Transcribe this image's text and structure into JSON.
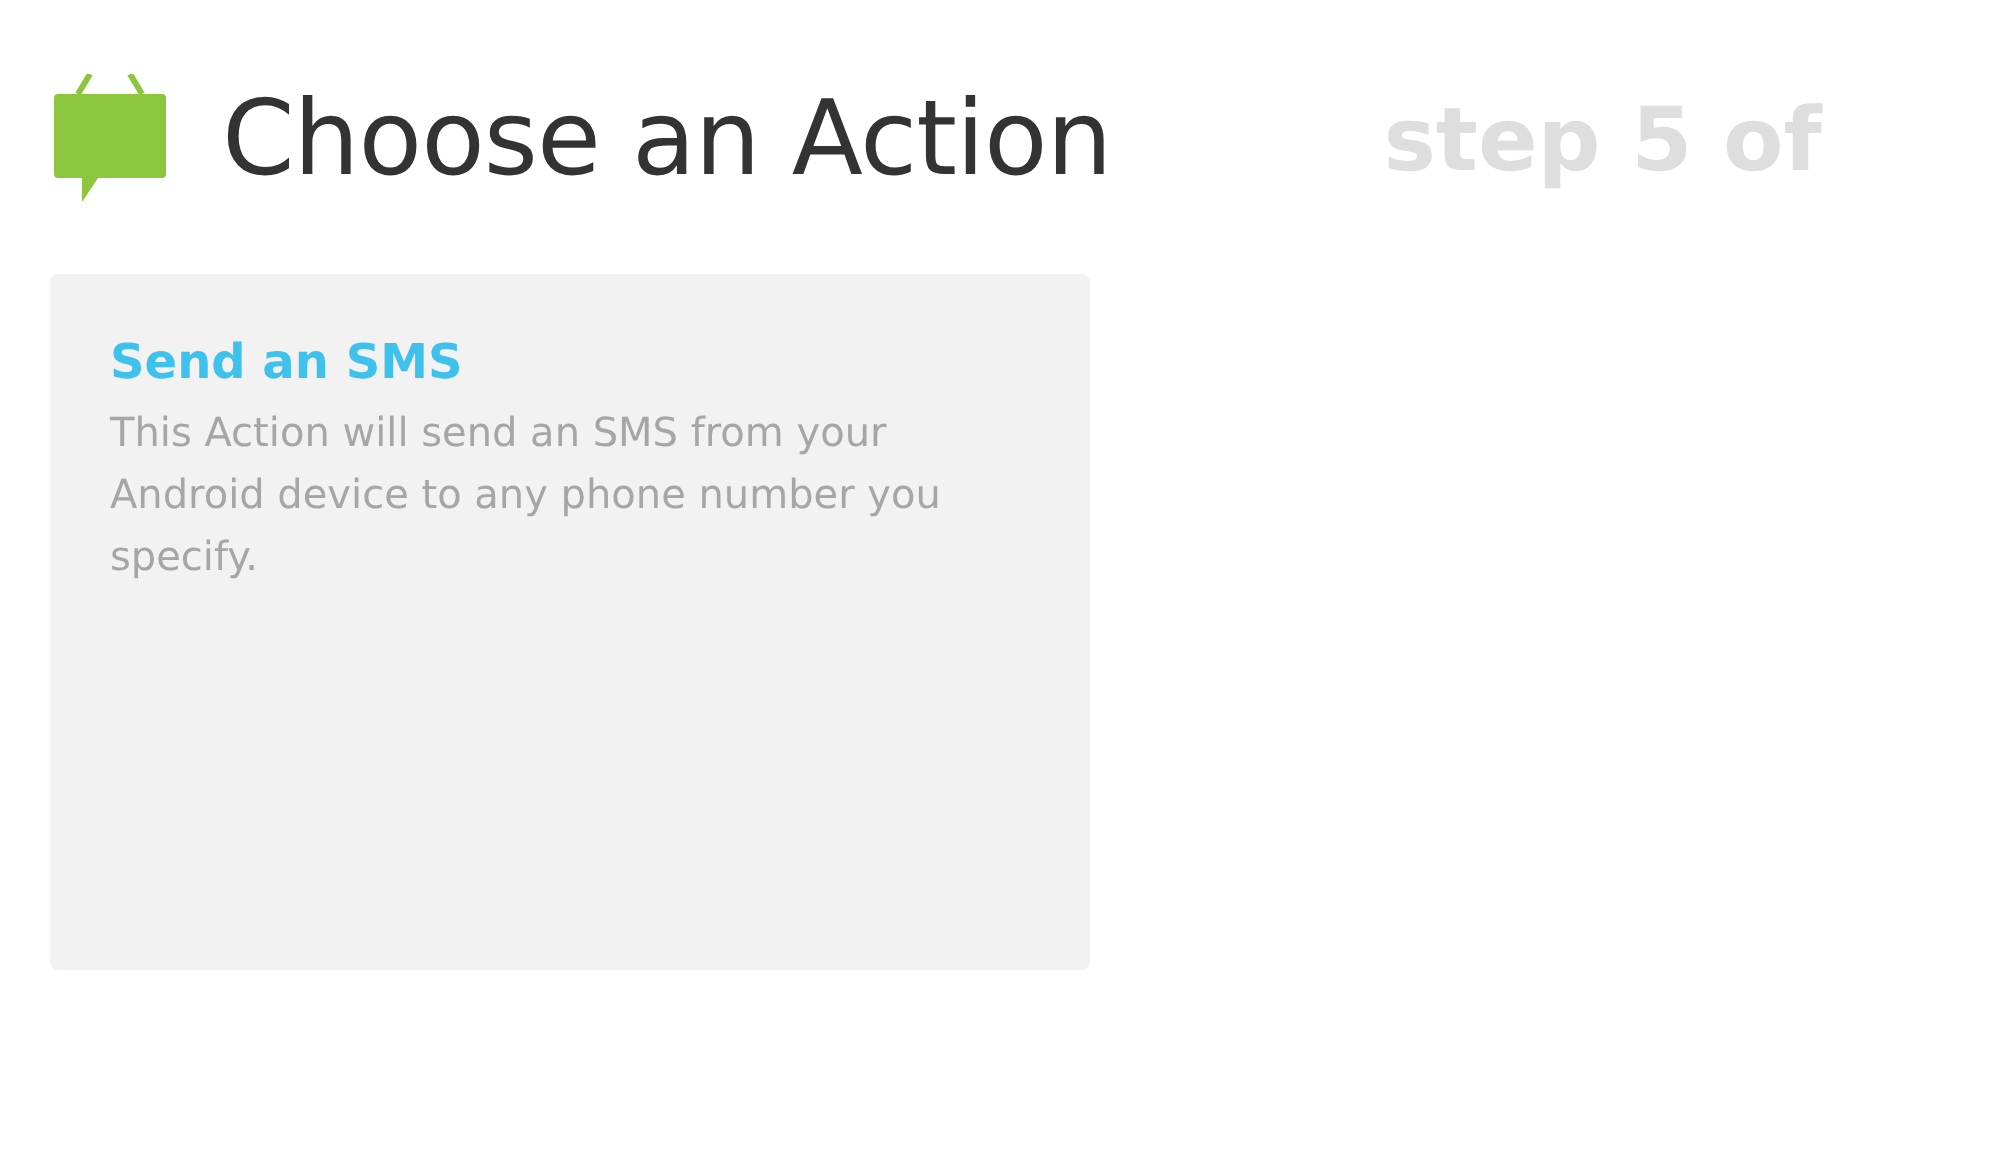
{
  "header": {
    "title": "Choose an Action",
    "step": "step 5 of"
  },
  "actions": [
    {
      "title": "Send an SMS",
      "description": "This Action will send an SMS from your Android device to any phone number you specify."
    }
  ]
}
